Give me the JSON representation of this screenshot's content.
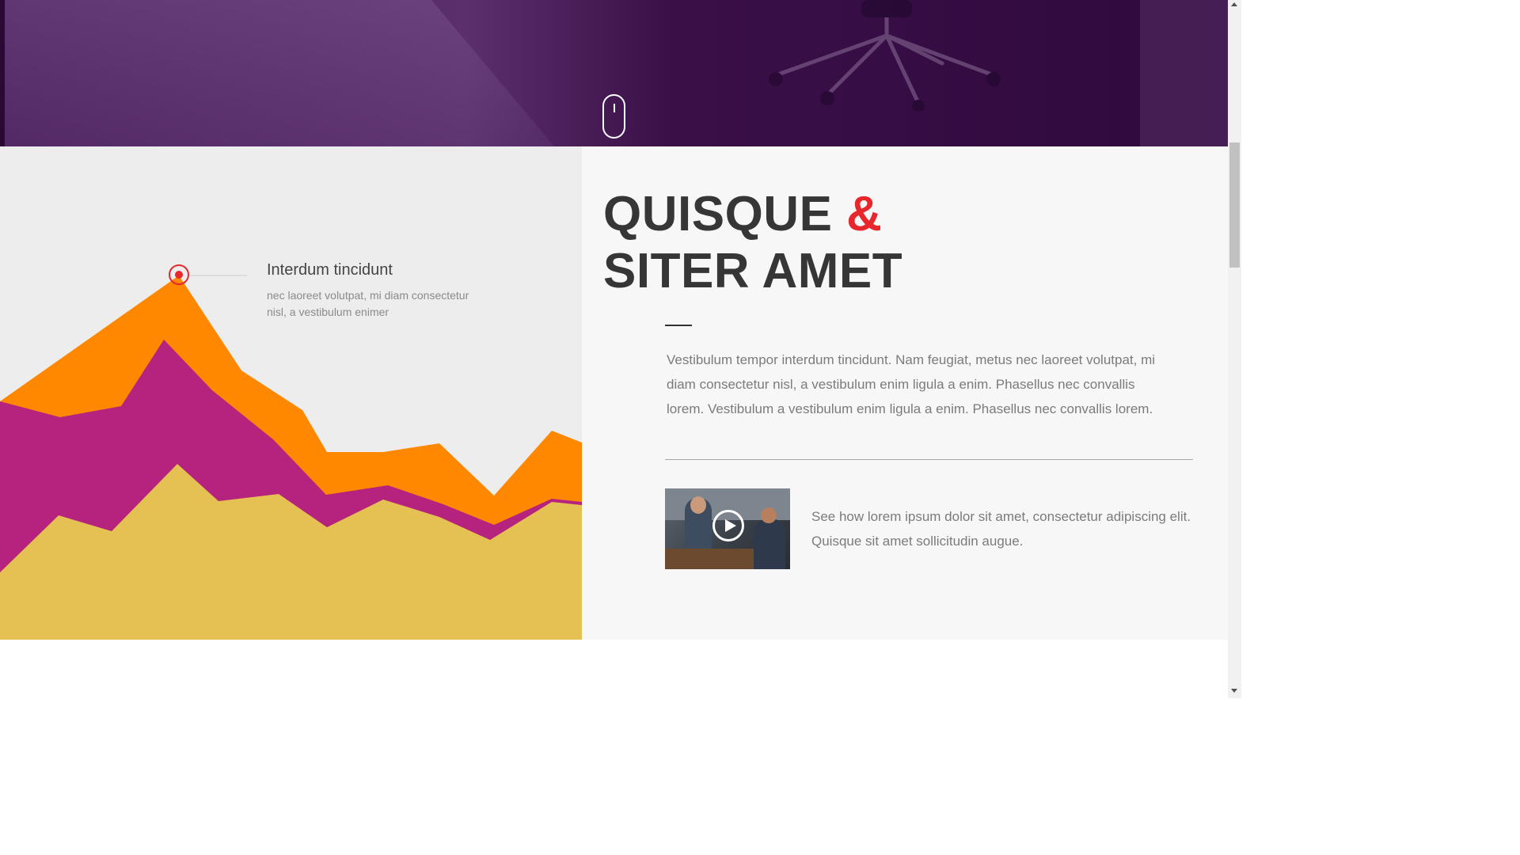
{
  "hero": {
    "scroll_hint_icon": "mouse-scroll-icon"
  },
  "chart": {
    "colors": {
      "back": "#ff8800",
      "middle": "#b5237e",
      "front": "#e4c152",
      "marker": "#e8272d"
    },
    "annotation": {
      "title": "Interdum tincidunt",
      "text": "nec laoreet volutpat, mi diam consectetur nisl, a vestibulum enimer"
    }
  },
  "content": {
    "headline_line1": "QUISQUE",
    "headline_amp": "&",
    "headline_line2": "SITER AMET",
    "lead": "Vestibulum tempor interdum tincidunt. Nam feugiat, metus nec laoreet volutpat, mi diam consectetur nisl, a vestibulum enim ligula a enim. Phasellus nec convallis lorem. Vestibulum a vestibulum enim ligula a enim. Phasellus nec convallis lorem.",
    "video_icon": "play-icon",
    "video_text": "See how lorem ipsum dolor sit amet, consectetur adipiscing elit. Quisque sit amet sollicitudin augue."
  },
  "theme": {
    "accent": "#e8272d",
    "hero_purple": "#3a0f48",
    "headline_color": "#363636"
  }
}
